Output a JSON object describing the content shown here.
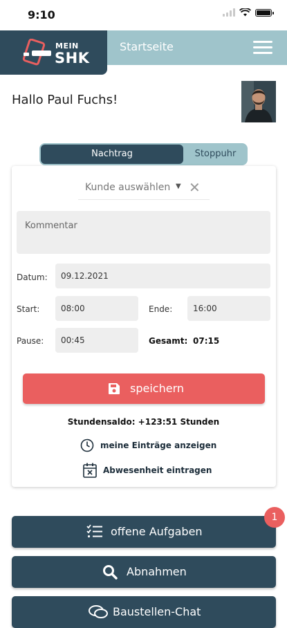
{
  "status_bar": {
    "time": "9:10"
  },
  "header": {
    "logo_small": "MEIN",
    "logo_big": "SHK",
    "title": "Startseite"
  },
  "greeting": "Hallo Paul Fuchs!",
  "tabs": [
    {
      "label": "Nachtrag",
      "active": true
    },
    {
      "label": "Stoppuhr",
      "active": false
    }
  ],
  "form": {
    "customer_placeholder": "Kunde auswählen",
    "comment_placeholder": "Kommentar",
    "date_label": "Datum:",
    "date_value": "09.12.2021",
    "start_label": "Start:",
    "start_value": "08:00",
    "end_label": "Ende:",
    "end_value": "16:00",
    "pause_label": "Pause:",
    "pause_value": "00:45",
    "total_label": "Gesamt:",
    "total_value": "07:15",
    "save_label": "speichern"
  },
  "balance": "Stundensaldo: +123:51 Stunden",
  "links": {
    "entries": "meine Einträge anzeigen",
    "absence": "Abwesenheit eintragen"
  },
  "buttons": {
    "tasks": "offene Aufgaben",
    "tasks_badge": "1",
    "inspections": "Abnahmen",
    "chat": "Baustellen-Chat"
  },
  "colors": {
    "primary": "#2f4b5c",
    "accent_light": "#9fc4cb",
    "danger": "#ea5f5f",
    "field_bg": "#eeeeee"
  },
  "icons": [
    "phone-logo-icon",
    "menu-icon",
    "caret-down-icon",
    "clear-icon",
    "save-icon",
    "clock-icon",
    "calendar-x-icon",
    "checklist-icon",
    "search-icon",
    "chat-icon"
  ]
}
